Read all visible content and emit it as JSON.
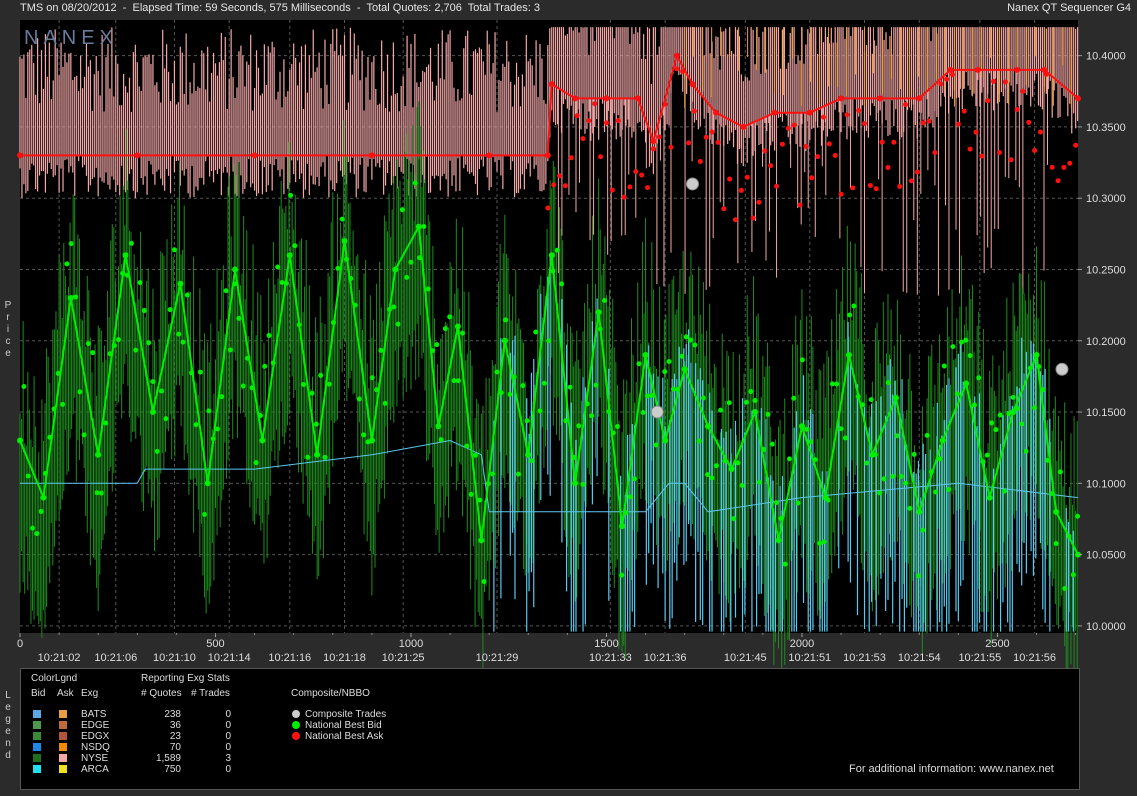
{
  "header": {
    "title": "TMS on 08/20/2012  -  Elapsed Time: 59 Seconds, 575 Milliseconds  -  Total Quotes: 2,706  Total Trades: 3",
    "product": "Nanex QT Sequencer G4",
    "watermark": "NANEX"
  },
  "side_labels": {
    "price": "Price",
    "legend": "Legend"
  },
  "chart_data": {
    "type": "line",
    "ylabel": "Price",
    "ylim": [
      9.995,
      10.425
    ],
    "xlim": [
      0,
      2706
    ],
    "yticks": [
      "10.0000",
      "10.0500",
      "10.1000",
      "10.1500",
      "10.2000",
      "10.2500",
      "10.3000",
      "10.3500",
      "10.4000"
    ],
    "ytick_values": [
      10.0,
      10.05,
      10.1,
      10.15,
      10.2,
      10.25,
      10.3,
      10.35,
      10.4
    ],
    "xticks": [
      "0",
      "500",
      "1000",
      "1500",
      "2000",
      "2500"
    ],
    "xtick_values": [
      0,
      500,
      1000,
      1500,
      2000,
      2500
    ],
    "time_labels": [
      {
        "t": "10:21:02",
        "q": 100
      },
      {
        "t": "10:21:06",
        "q": 245
      },
      {
        "t": "10:21:10",
        "q": 395
      },
      {
        "t": "10:21:14",
        "q": 535
      },
      {
        "t": "10:21:16",
        "q": 690
      },
      {
        "t": "10:21:18",
        "q": 830
      },
      {
        "t": "10:21:25",
        "q": 980
      },
      {
        "t": "10:21:29",
        "q": 1220
      },
      {
        "t": "10:21:33",
        "q": 1510
      },
      {
        "t": "10:21:36",
        "q": 1650
      },
      {
        "t": "10:21:45",
        "q": 1855
      },
      {
        "t": "10:21:51",
        "q": 2020
      },
      {
        "t": "10:21:53",
        "q": 2160
      },
      {
        "t": "10:21:54",
        "q": 2300
      },
      {
        "t": "10:21:55",
        "q": 2455
      },
      {
        "t": "10:21:56",
        "q": 2595
      }
    ],
    "grid": true,
    "colors": {
      "nbb": "#00ee00",
      "nbo": "#ff1010",
      "trade": "#cccccc",
      "bid_line": "#5ac8f0",
      "bid_green": "#1f8c1f",
      "ask_pink": "#f3a8a8",
      "ask_orange": "#f0a030"
    },
    "series": [
      {
        "name": "National Best Bid",
        "color": "#00ee00",
        "points": [
          [
            0,
            10.13
          ],
          [
            60,
            10.09
          ],
          [
            130,
            10.23
          ],
          [
            200,
            10.12
          ],
          [
            270,
            10.26
          ],
          [
            340,
            10.15
          ],
          [
            410,
            10.24
          ],
          [
            480,
            10.1
          ],
          [
            550,
            10.25
          ],
          [
            620,
            10.13
          ],
          [
            690,
            10.26
          ],
          [
            760,
            10.12
          ],
          [
            830,
            10.27
          ],
          [
            900,
            10.13
          ],
          [
            960,
            10.25
          ],
          [
            1020,
            10.28
          ],
          [
            1070,
            10.14
          ],
          [
            1120,
            10.21
          ],
          [
            1180,
            10.06
          ],
          [
            1240,
            10.2
          ],
          [
            1300,
            10.12
          ],
          [
            1360,
            10.26
          ],
          [
            1420,
            10.1
          ],
          [
            1480,
            10.22
          ],
          [
            1540,
            10.07
          ],
          [
            1600,
            10.19
          ],
          [
            1650,
            10.13
          ],
          [
            1700,
            10.18
          ],
          [
            1760,
            10.14
          ],
          [
            1820,
            10.11
          ],
          [
            1880,
            10.15
          ],
          [
            1940,
            10.06
          ],
          [
            2000,
            10.14
          ],
          [
            2060,
            10.09
          ],
          [
            2120,
            10.19
          ],
          [
            2180,
            10.12
          ],
          [
            2240,
            10.16
          ],
          [
            2300,
            10.08
          ],
          [
            2360,
            10.13
          ],
          [
            2420,
            10.17
          ],
          [
            2480,
            10.09
          ],
          [
            2540,
            10.15
          ],
          [
            2600,
            10.19
          ],
          [
            2650,
            10.08
          ],
          [
            2706,
            10.05
          ]
        ]
      },
      {
        "name": "National Best Ask",
        "color": "#ff1010",
        "points": [
          [
            0,
            10.33
          ],
          [
            300,
            10.33
          ],
          [
            600,
            10.33
          ],
          [
            900,
            10.33
          ],
          [
            1200,
            10.33
          ],
          [
            1350,
            10.33
          ],
          [
            1360,
            10.38
          ],
          [
            1420,
            10.37
          ],
          [
            1500,
            10.37
          ],
          [
            1580,
            10.37
          ],
          [
            1620,
            10.34
          ],
          [
            1680,
            10.4
          ],
          [
            1720,
            10.38
          ],
          [
            1780,
            10.36
          ],
          [
            1850,
            10.35
          ],
          [
            1930,
            10.36
          ],
          [
            2020,
            10.36
          ],
          [
            2100,
            10.37
          ],
          [
            2200,
            10.37
          ],
          [
            2300,
            10.37
          ],
          [
            2380,
            10.39
          ],
          [
            2450,
            10.39
          ],
          [
            2550,
            10.39
          ],
          [
            2620,
            10.39
          ],
          [
            2706,
            10.37
          ]
        ]
      },
      {
        "name": "Composite Trades",
        "color": "#cccccc",
        "points": [
          [
            1630,
            10.15
          ],
          [
            1720,
            10.31
          ],
          [
            2665,
            10.18
          ]
        ]
      }
    ]
  },
  "legend": {
    "color_legend": "ColorLgnd",
    "reporting": "Reporting Exg Stats",
    "col_bid": "Bid",
    "col_ask": "Ask",
    "col_exg": "Exg",
    "col_quotes": "# Quotes",
    "col_trades": "# Trades",
    "composite_title": "Composite/NBBO",
    "exchanges": [
      {
        "name": "BATS",
        "quotes": "238",
        "trades": "0",
        "bid": "#5aa9e6",
        "ask": "#e8a040"
      },
      {
        "name": "EDGE",
        "quotes": "36",
        "trades": "0",
        "bid": "#4c9a4c",
        "ask": "#c06a3c"
      },
      {
        "name": "EDGX",
        "quotes": "23",
        "trades": "0",
        "bid": "#3a8a3a",
        "ask": "#b0563a"
      },
      {
        "name": "NSDQ",
        "quotes": "70",
        "trades": "0",
        "bid": "#1e88e5",
        "ask": "#f08c00"
      },
      {
        "name": "NYSE",
        "quotes": "1,589",
        "trades": "3",
        "bid": "#1f6f1f",
        "ask": "#f3a8a8"
      },
      {
        "name": "ARCA",
        "quotes": "750",
        "trades": "0",
        "bid": "#20e0f0",
        "ask": "#f0e020"
      }
    ],
    "composite": [
      {
        "label": "Composite Trades",
        "color": "#cccccc"
      },
      {
        "label": "National Best Bid",
        "color": "#00ee00"
      },
      {
        "label": "National Best Ask",
        "color": "#ff1010"
      }
    ],
    "footer": "For additional information: www.nanex.net"
  }
}
